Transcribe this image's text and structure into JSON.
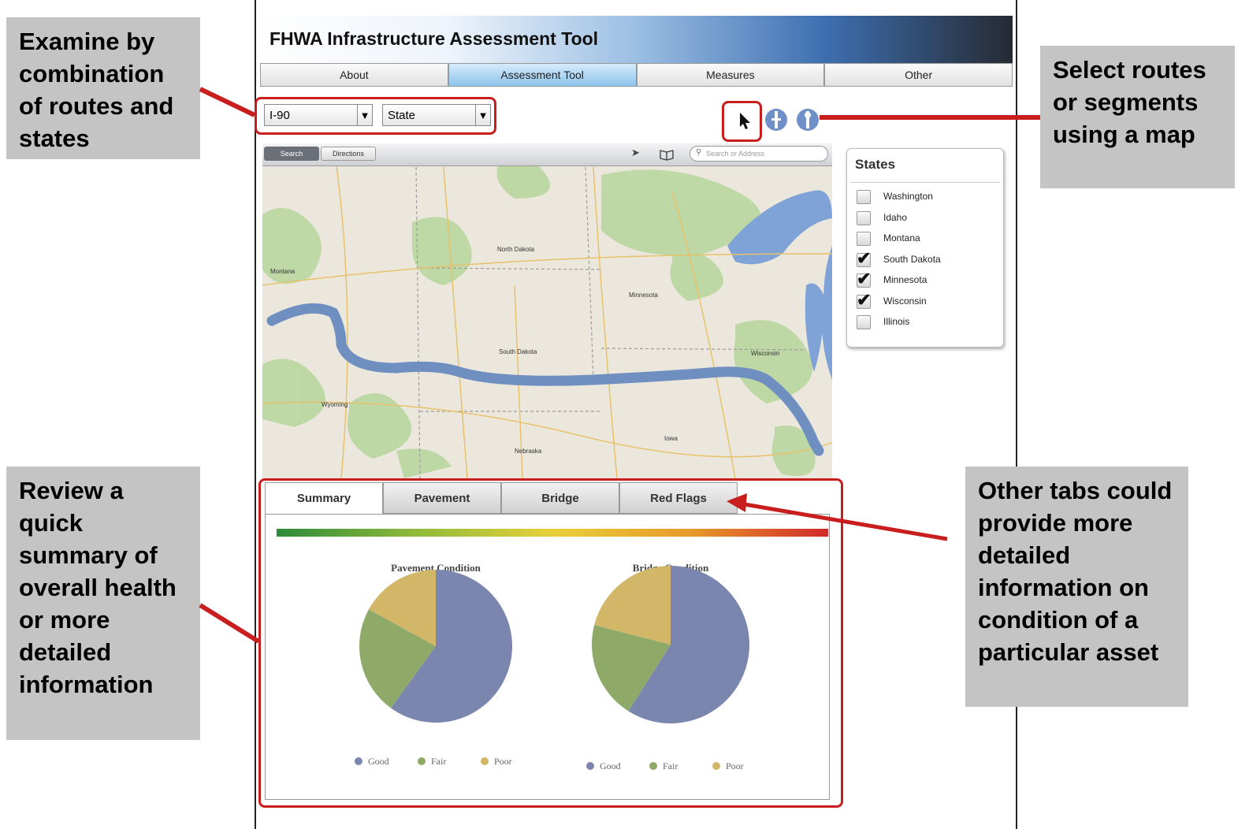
{
  "app": {
    "title": "FHWA Infrastructure Assessment Tool",
    "nav_tabs": [
      "About",
      "Assessment Tool",
      "Measures",
      "Other"
    ],
    "active_nav": "Assessment Tool"
  },
  "filters": {
    "route": "I-90",
    "state": "State"
  },
  "map": {
    "toolbar": {
      "search_tab": "Search",
      "directions_tab": "Directions",
      "search_placeholder": "Search or Address"
    },
    "labels": [
      "North Dakota",
      "South Dakota",
      "Minnesota",
      "Wyoming",
      "Montana",
      "Nebraska",
      "Wisconsin",
      "Iowa"
    ]
  },
  "states_panel": {
    "title": "States",
    "items": [
      {
        "label": "Washington",
        "checked": false
      },
      {
        "label": "Idaho",
        "checked": false
      },
      {
        "label": "Montana",
        "checked": false
      },
      {
        "label": "South Dakota",
        "checked": true
      },
      {
        "label": "Minnesota",
        "checked": true
      },
      {
        "label": "Wisconsin",
        "checked": true
      },
      {
        "label": "Illinois",
        "checked": false
      }
    ]
  },
  "summary_tabs": [
    "Summary",
    "Pavement",
    "Bridge",
    "Red Flags"
  ],
  "active_summary_tab": "Summary",
  "colors": {
    "good": "#7a86ad",
    "fair": "#8faa68",
    "poor": "#d2b768",
    "callout_bg": "#c4c4c4",
    "annotation_red": "#c81e1e",
    "route": "#6f8fc0"
  },
  "chart_data": [
    {
      "type": "pie",
      "title": "Pavement Condition",
      "categories": [
        "Good",
        "Fair",
        "Poor"
      ],
      "values": [
        60,
        23,
        17
      ]
    },
    {
      "type": "pie",
      "title": "Bridge Condition",
      "categories": [
        "Good",
        "Fair",
        "Poor"
      ],
      "values": [
        59,
        20,
        21
      ]
    }
  ],
  "callouts": [
    {
      "text": "Examine by combination of routes and states"
    },
    {
      "text": "Select routes or segments using a map"
    },
    {
      "text": "Review a quick summary of overall health or more detailed information"
    },
    {
      "text": "Other tabs could provide more detailed information on condition of a particular asset"
    }
  ]
}
